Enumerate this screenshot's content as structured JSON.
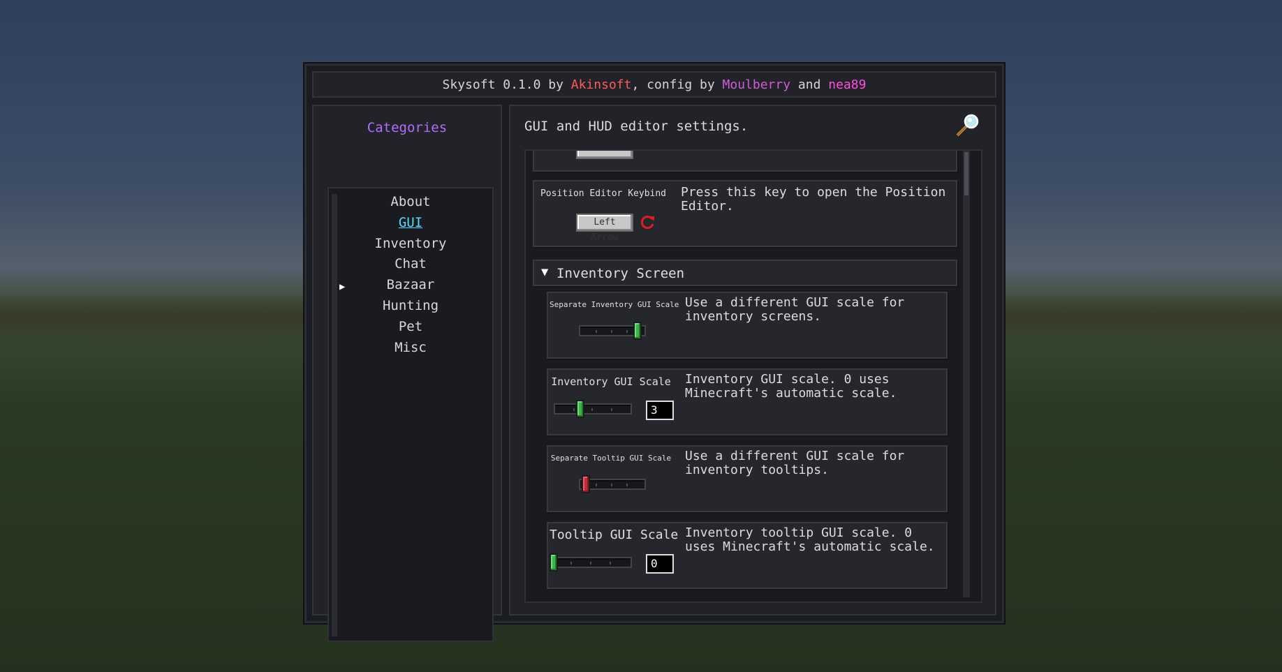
{
  "title": {
    "parts": [
      {
        "text": "Skysoft 0.1.0 by ",
        "color": "#d6d6d6"
      },
      {
        "text": "Akinsoft",
        "color": "#ff5a5a"
      },
      {
        "text": ", config by ",
        "color": "#d6d6d6"
      },
      {
        "text": "Moulberry",
        "color": "#d15bd8"
      },
      {
        "text": " and ",
        "color": "#d6d6d6"
      },
      {
        "text": "nea89",
        "color": "#ff4fe0"
      }
    ]
  },
  "sidebar": {
    "heading": "Categories",
    "items": [
      {
        "label": "About",
        "active": false
      },
      {
        "label": "GUI",
        "active": true
      },
      {
        "label": "Inventory",
        "active": false
      },
      {
        "label": "Chat",
        "active": false
      },
      {
        "label": "Bazaar",
        "active": false
      },
      {
        "label": "Hunting",
        "active": false
      },
      {
        "label": "Pet",
        "active": false
      },
      {
        "label": "Misc",
        "active": false
      }
    ]
  },
  "main": {
    "description": "GUI and HUD editor settings.",
    "search_icon": "magnifying-glass-icon",
    "options": {
      "position_editor": {
        "label": "Position Editor Keybind",
        "description": "Press this key to open the Position Editor.",
        "value": "Left Arrow",
        "reset_icon": "reset-icon"
      },
      "section": {
        "title": "Inventory Screen",
        "arrow": "▼"
      },
      "separate_inventory_scale": {
        "label": "Separate Inventory GUI Scale",
        "description": "Use a different GUI scale for inventory screens.",
        "enabled": true
      },
      "inventory_gui_scale": {
        "label": "Inventory GUI Scale",
        "description": "Inventory GUI scale. 0 uses Minecraft's automatic scale.",
        "value": "3",
        "level": 0.35
      },
      "separate_tooltip_scale": {
        "label": "Separate Tooltip GUI Scale",
        "description": "Use a different GUI scale for inventory tooltips.",
        "enabled": false
      },
      "tooltip_gui_scale": {
        "label": "Tooltip GUI Scale",
        "description": "Inventory tooltip GUI scale. 0 uses Minecraft's automatic scale.",
        "value": "0",
        "level": 0.0
      }
    }
  },
  "colors": {
    "category_heading": "#b46cff",
    "active_category": "#55d9ff",
    "toggle_on": "#39b54a",
    "toggle_off": "#c9283a",
    "reset_icon": "#e01e1e"
  }
}
